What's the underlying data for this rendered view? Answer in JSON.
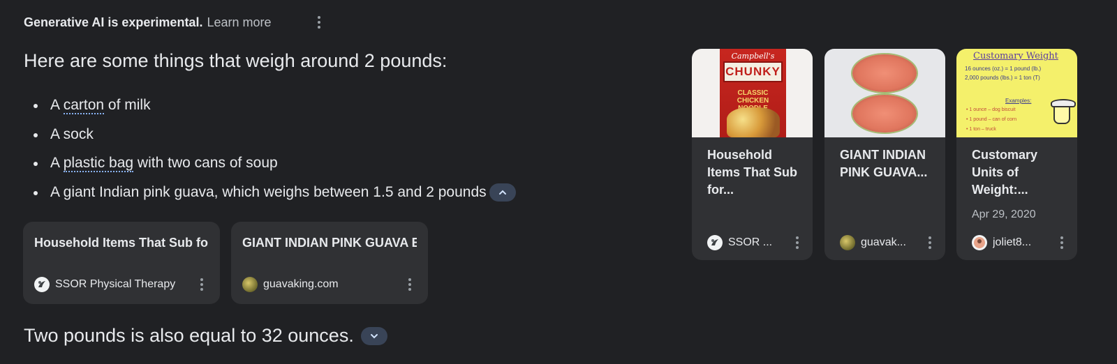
{
  "header": {
    "experimental_label": "Generative AI is experimental.",
    "learn_more": "Learn more"
  },
  "answer": {
    "headline": "Here are some things that weigh around 2 pounds:",
    "items": [
      {
        "pre": "A ",
        "link": "carton",
        "post": " of milk"
      },
      {
        "pre": "A sock",
        "link": "",
        "post": ""
      },
      {
        "pre": "A ",
        "link": "plastic bag",
        "post": " with two cans of soup"
      },
      {
        "pre": "A giant Indian pink guava, which weighs between 1.5 and 2 pounds",
        "link": "",
        "post": ""
      }
    ],
    "footer": "Two pounds is also equal to 32 ounces."
  },
  "source_cards": [
    {
      "title": "Household Items That Sub for Weights - SSOR Physic...",
      "source": "SSOR Physical Therapy",
      "icon": "ssor-favicon-icon"
    },
    {
      "title": "GIANT INDIAN PINK GUAVA EXTREMELY RARE FRUIT ...",
      "source": "guavaking.com",
      "icon": "guava-favicon-icon"
    }
  ],
  "image_cards": [
    {
      "title": "Household Items That Sub for...",
      "source": "SSOR ...",
      "date": "",
      "image": "campbells-chunky-soup-can"
    },
    {
      "title": "GIANT INDIAN PINK GUAVA...",
      "source": "guavak...",
      "date": "",
      "image": "pink-guava-halves"
    },
    {
      "title": "Customary Units of Weight:...",
      "source": "joliet8...",
      "date": "Apr 29, 2020",
      "image": "customary-weight-chart"
    }
  ],
  "thumbnails": {
    "soup": {
      "brand": "Campbell's",
      "name": "CHUNKY",
      "sub": "CLASSIC CHICKEN NOODLE"
    },
    "weight": {
      "title": "Customary Weight",
      "lines": [
        "16 ounces (oz.) = 1 pound (lb.)",
        "2,000 pounds (lbs.) = 1 ton (T)"
      ],
      "examples_label": "Examples:",
      "examples": [
        "• 1 ounce – dog biscuit",
        "• 1 pound – can of corn",
        "• 1 ton – truck"
      ]
    }
  },
  "colors": {
    "background": "#202124",
    "card": "#303134",
    "pill": "#394457",
    "link_underline": "#8ab4f8"
  }
}
